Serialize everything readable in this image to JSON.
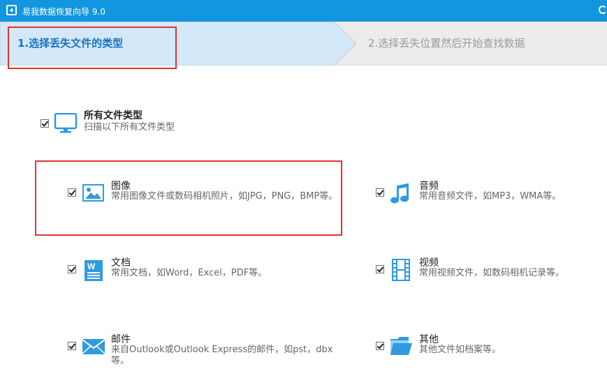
{
  "window": {
    "title": "易我数据恢复向导 9.0"
  },
  "steps": [
    {
      "label": "1.选择丢失文件的类型"
    },
    {
      "label": "2.选择丢失位置然后开始查找数据"
    }
  ],
  "all_types": {
    "title": "所有文件类型",
    "description": "扫描以下所有文件类型",
    "checked": true,
    "icon": "monitor-icon"
  },
  "file_types": [
    {
      "title": "图像",
      "description": "常用图像文件或数码相机照片，如JPG，PNG，BMP等。",
      "checked": true,
      "icon": "image-icon"
    },
    {
      "title": "音频",
      "description": "常用音频文件，如MP3，WMA等。",
      "checked": true,
      "icon": "music-note-icon"
    },
    {
      "title": "文档",
      "description": "常用文档，如Word，Excel，PDF等。",
      "checked": true,
      "icon": "word-document-icon"
    },
    {
      "title": "视频",
      "description": "常用视频文件，如数码相机记录等。",
      "checked": true,
      "icon": "film-icon"
    },
    {
      "title": "邮件",
      "description": "来自Outlook或Outlook Express的邮件，如pst，dbx等。",
      "checked": true,
      "icon": "envelope-icon"
    },
    {
      "title": "其他",
      "description": "其他文件如档案等。",
      "checked": true,
      "icon": "folder-icon"
    }
  ],
  "colors": {
    "titlebar": "#1196df",
    "active_step_text": "#1a73c4",
    "icon_blue": "#2f9ae0",
    "highlight_red": "#e0342f"
  }
}
